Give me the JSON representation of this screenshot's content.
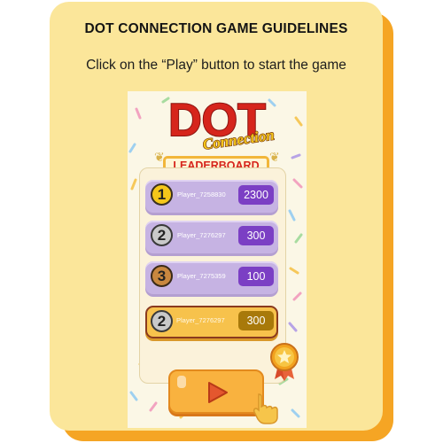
{
  "guidelines": {
    "heading": "DOT CONNECTION GAME GUIDELINES",
    "instruction": "Click on the “Play” button to start the game"
  },
  "game": {
    "logo_lines": [
      "DOT",
      "Connection"
    ],
    "leaderboard_title": "LEADERBOARD",
    "leaderboard": [
      {
        "rank": "1",
        "player": "Player_7258830",
        "score": "2300",
        "style": "first"
      },
      {
        "rank": "2",
        "player": "Player_7276297",
        "score": "300",
        "style": "second"
      },
      {
        "rank": "3",
        "player": "Player_7275359",
        "score": "100",
        "style": "third"
      }
    ],
    "current_player": {
      "rank": "2",
      "player": "Player_7276297",
      "score": "300"
    },
    "play_button_icon": "play-triangle-icon",
    "cursor_icon": "pointing-hand-icon",
    "badge_icon": "star-medal-icon"
  },
  "colors": {
    "card_bg": "#fbe69a",
    "card_shadow": "#f5a524",
    "row_purple": "#c6b3e3",
    "score_purple": "#7b3fc4",
    "row_gold": "#f7c24c",
    "logo_red": "#d6251c",
    "logo_yellow": "#f5c61a"
  }
}
